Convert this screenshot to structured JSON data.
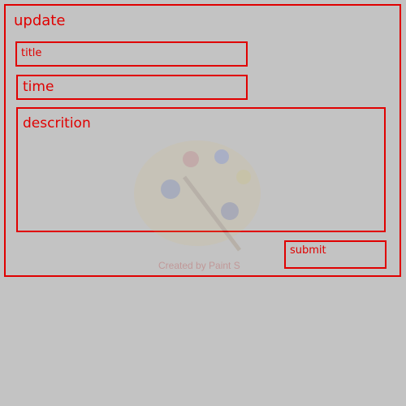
{
  "form": {
    "heading": "update",
    "title_label": "title",
    "time_label": "time",
    "description_label": "descrition",
    "submit_label": "submit"
  },
  "watermark": {
    "text": "Created by Paint S",
    "icon": "paint-palette-icon"
  },
  "colors": {
    "background": "#c3c3c3",
    "accent": "#e00000"
  }
}
